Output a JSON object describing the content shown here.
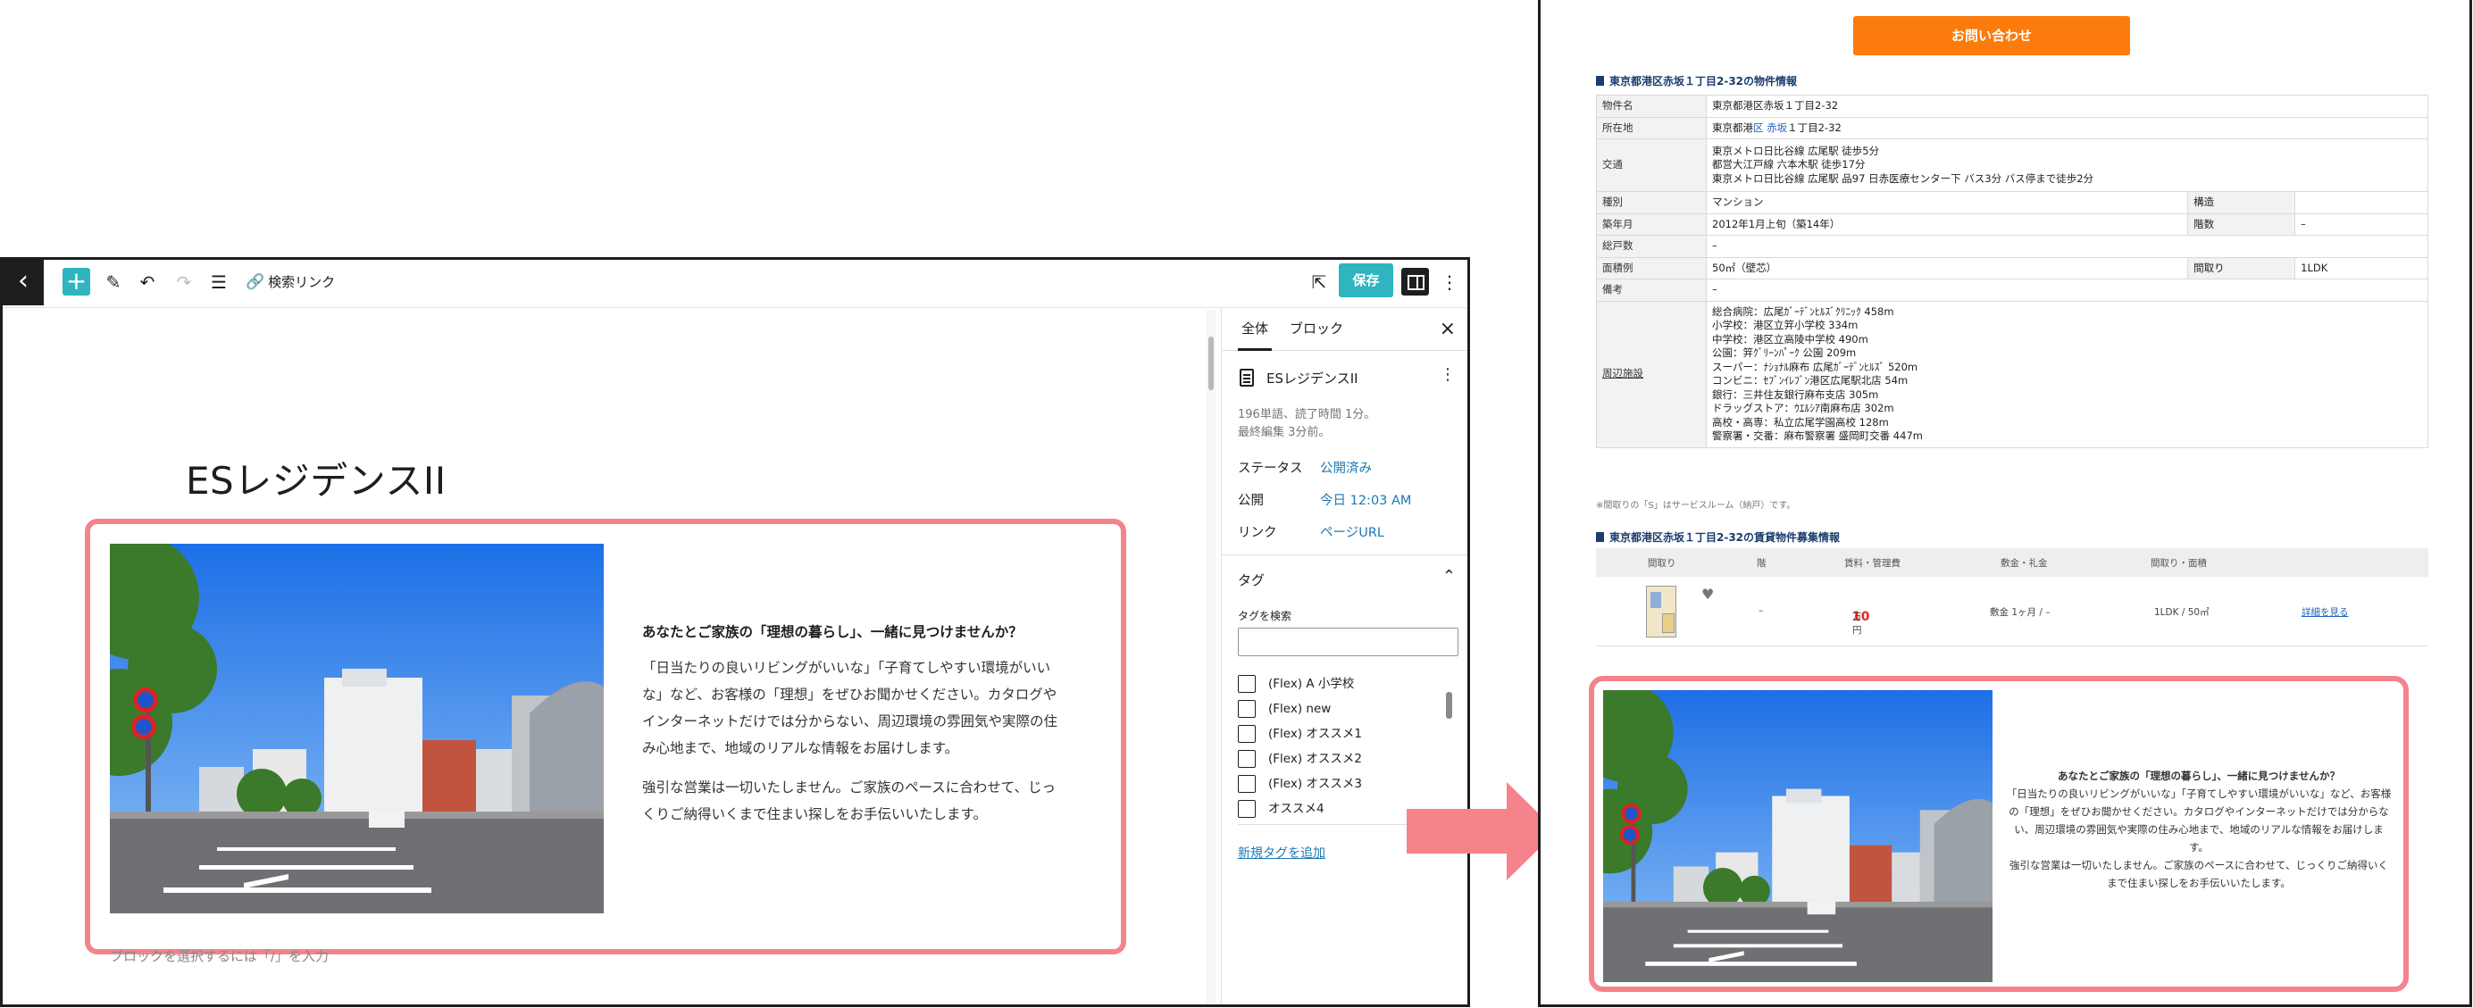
{
  "editor": {
    "toolbar": {
      "search_link_label": "検索リンク",
      "save_label": "保存"
    },
    "post_title": "ESレジデンスII",
    "block": {
      "heading": "あなたとご家族の「理想の暮らし」、一緒に見つけませんか？",
      "paragraph1": "「日当たりの良いリビングがいいな」「子育てしやすい環境がいいな」など、お客様の「理想」をぜひお聞かせください。カタログやインターネットだけでは分からない、周辺環境の雰囲気や実際の住み心地まで、地域のリアルな情報をお届けします。",
      "paragraph2": "強引な営業は一切いたしません。ご家族のペースに合わせて、じっくりご納得いくまで住まい探しをお手伝いいたします。",
      "placeholder": "ブロックを選択するには「/」を入力"
    },
    "sidebar": {
      "tab_all": "全体",
      "tab_block": "ブロック",
      "doc_title": "ESレジデンスII",
      "word_count": "196単語、読了時間 1分。",
      "last_edited": "最終編集 3分前。",
      "status_label": "ステータス",
      "status_value": "公開済み",
      "publish_label": "公開",
      "publish_value": "今日 12:03 AM",
      "link_label": "リンク",
      "link_value": "ページURL",
      "tags_title": "タグ",
      "tag_search_label": "タグを検索",
      "tags": [
        "(Flex) A 小学校",
        "(Flex) new",
        "(Flex) オススメ1",
        "(Flex) オススメ2",
        "(Flex) オススメ3",
        "オススメ4"
      ],
      "add_tag": "新規タグを追加"
    }
  },
  "preview": {
    "contact_button": "お問い合わせ",
    "property_section_title": "東京都港区赤坂１丁目2-32の物件情報",
    "property": {
      "name_label": "物件名",
      "name": "東京都港区赤坂１丁目2-32",
      "address_label": "所在地",
      "address_prefix": "東京都港",
      "address_link": "区 赤坂",
      "address_suffix": "１丁目2-32",
      "transit_label": "交通",
      "transit": [
        "東京メトロ日比谷線 広尾駅 徒歩5分",
        "都営大江戸線 六本木駅 徒歩17分",
        "東京メトロ日比谷線 広尾駅 品97 日赤医療センター下 バス3分 バス停まで徒歩2分"
      ],
      "type_label": "種別",
      "type": "マンション",
      "structure_label": "構造",
      "structure": "",
      "built_label": "築年月",
      "built": "2012年1月上旬（築14年）",
      "floors_label": "階数",
      "floors": "–",
      "units_label": "総戸数",
      "units": "–",
      "area_label": "面積例",
      "area": "50㎡（壁芯）",
      "layout_label": "間取り",
      "layout": "1LDK",
      "notes_label": "備考",
      "notes": "–",
      "surroundings_label": "周辺施設",
      "surroundings": [
        "総合病院：広尾ｶﾞｰﾃﾞﾝﾋﾙｽﾞｸﾘﾆｯｸ 458m",
        "小学校：港区立笄小学校 334m",
        "中学校：港区立高陵中学校 490m",
        "公園：笄ｸﾞﾘｰﾝﾊﾟｰｸ 公園 209m",
        "スーパー：ﾅｼｮﾅﾙ麻布 広尾ｶﾞｰﾃﾞﾝﾋﾙｽﾞ 520m",
        "コンビニ：ｾﾌﾞﾝｲﾚﾌﾞﾝ港区広尾駅北店 54m",
        "銀行：三井住友銀行麻布支店 305m",
        "ドラッグストア：ｳｴﾙｼｱ南麻布店 302m",
        "高校・高専：私立広尾学園高校 128m",
        "警察署・交番：麻布警察署 盛岡町交番 447m"
      ]
    },
    "note": "※間取りの「S」はサービスルーム（納戸）です。",
    "rent_section_title": "東京都港区赤坂１丁目2-32の賃貸物件募集情報",
    "rent_headers": [
      "間取り",
      "階",
      "賃料・管理費",
      "敷金・礼金",
      "間取り・面積"
    ],
    "rent_row": {
      "floor": "–",
      "price": "10",
      "price_unit": "万円",
      "deposit": "敷金 1ヶ月 / –",
      "layout": "1LDK / 50㎡",
      "detail": "詳細を見る"
    },
    "block": {
      "heading": "あなたとご家族の「理想の暮らし」、一緒に見つけませんか？",
      "paragraph1": "「日当たりの良いリビングがいいな」「子育てしやすい環境がいいな」など、お客様の「理想」をぜひお聞かせください。カタログやインターネットだけでは分からない、周辺環境の雰囲気や実際の住み心地まで、地域のリアルな情報をお届けします。",
      "paragraph2": "強引な営業は一切いたしません。ご家族のペースに合わせて、じっくりご納得いくまで住まい探しをお手伝いいたします。"
    }
  },
  "colors": {
    "accent": "#2fb4c0",
    "highlight_border": "#f4838c",
    "contact_button": "#fb7b0c",
    "arrow": "#f4838c"
  }
}
